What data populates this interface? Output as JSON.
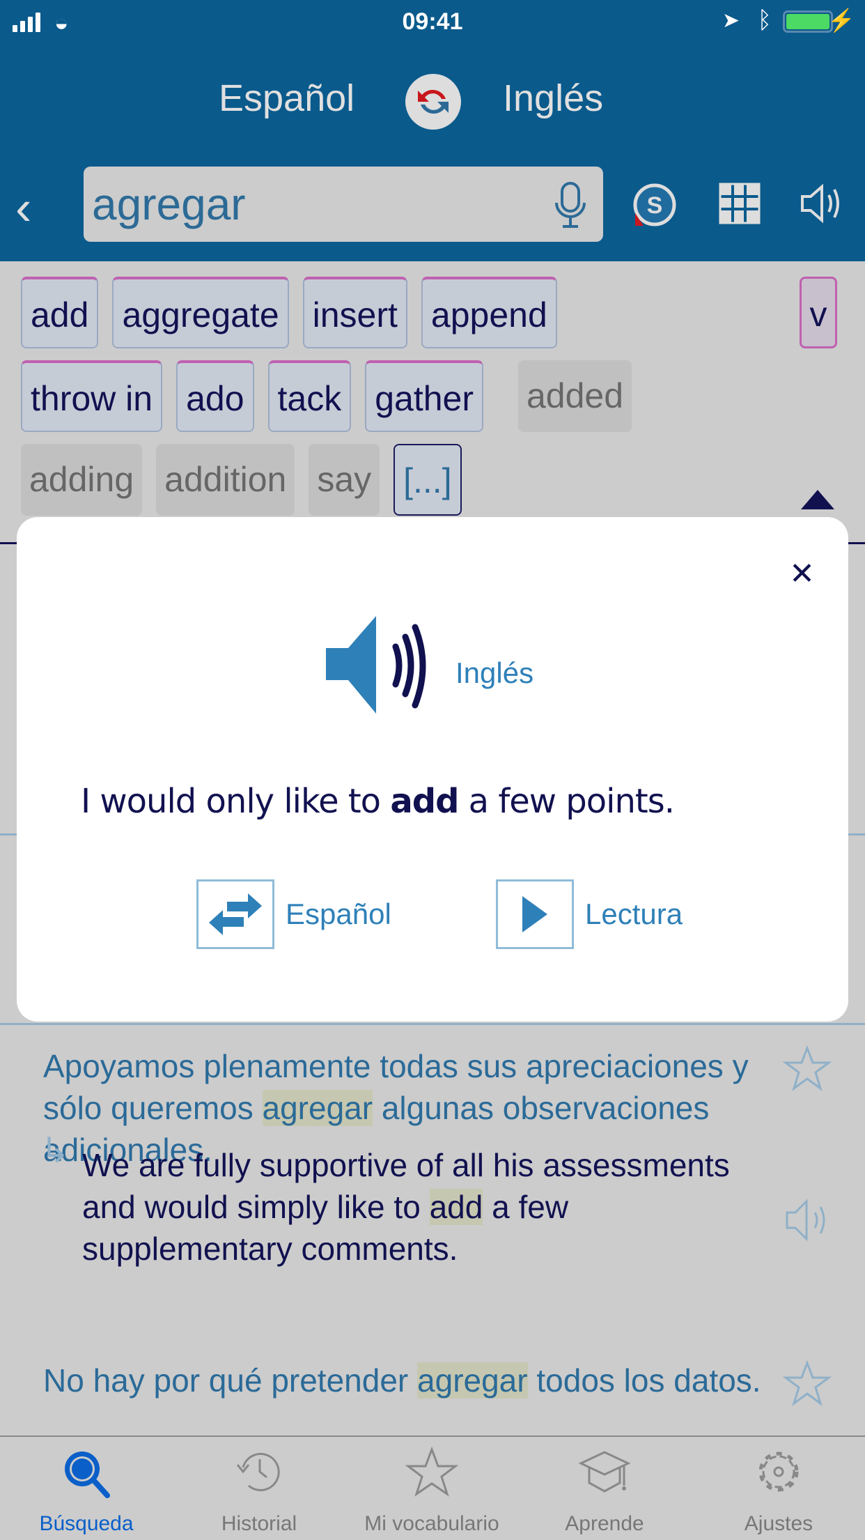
{
  "status_bar": {
    "time": "09:41"
  },
  "header": {
    "source_lang": "Español",
    "target_lang": "Inglés"
  },
  "search": {
    "value": "agregar"
  },
  "chips": {
    "row1": [
      "add",
      "aggregate",
      "insert",
      "append"
    ],
    "pos": "v",
    "row2": [
      "throw in",
      "ado",
      "tack",
      "gather"
    ],
    "row2_gray": [
      "added"
    ],
    "row3_gray": [
      "adding",
      "addition",
      "say"
    ],
    "more": "[...]"
  },
  "modal": {
    "lang": "Inglés",
    "sentence_before": "I would only like to ",
    "sentence_bold": "add",
    "sentence_after": " a few points.",
    "translate_label": "Español",
    "read_label": "Lectura"
  },
  "results": [
    {
      "es_1": "Apoyamos plenamente todas sus apreciaciones y sólo queremos ",
      "es_hl": "agregar",
      "es_2": " algunas observaciones adicionales.",
      "en_1": "We are fully supportive of all his assessments and would simply like to ",
      "en_hl": "add",
      "en_2": " a few supplementary comments."
    },
    {
      "es_1": "No hay por qué pretender ",
      "es_hl": "agregar",
      "es_2": " todos los datos."
    }
  ],
  "tabs": [
    {
      "label": "Búsqueda",
      "icon": "search-icon",
      "active": true
    },
    {
      "label": "Historial",
      "icon": "history-icon"
    },
    {
      "label": "Mi vocabulario",
      "icon": "star-icon"
    },
    {
      "label": "Aprende",
      "icon": "graduation-cap-icon"
    },
    {
      "label": "Ajustes",
      "icon": "gear-icon"
    }
  ],
  "colors": {
    "header": "#0a5a8c",
    "accent": "#2e80b8",
    "navy": "#111150",
    "active_tab": "#0a5fc8",
    "highlight": "#c6c7b0"
  }
}
